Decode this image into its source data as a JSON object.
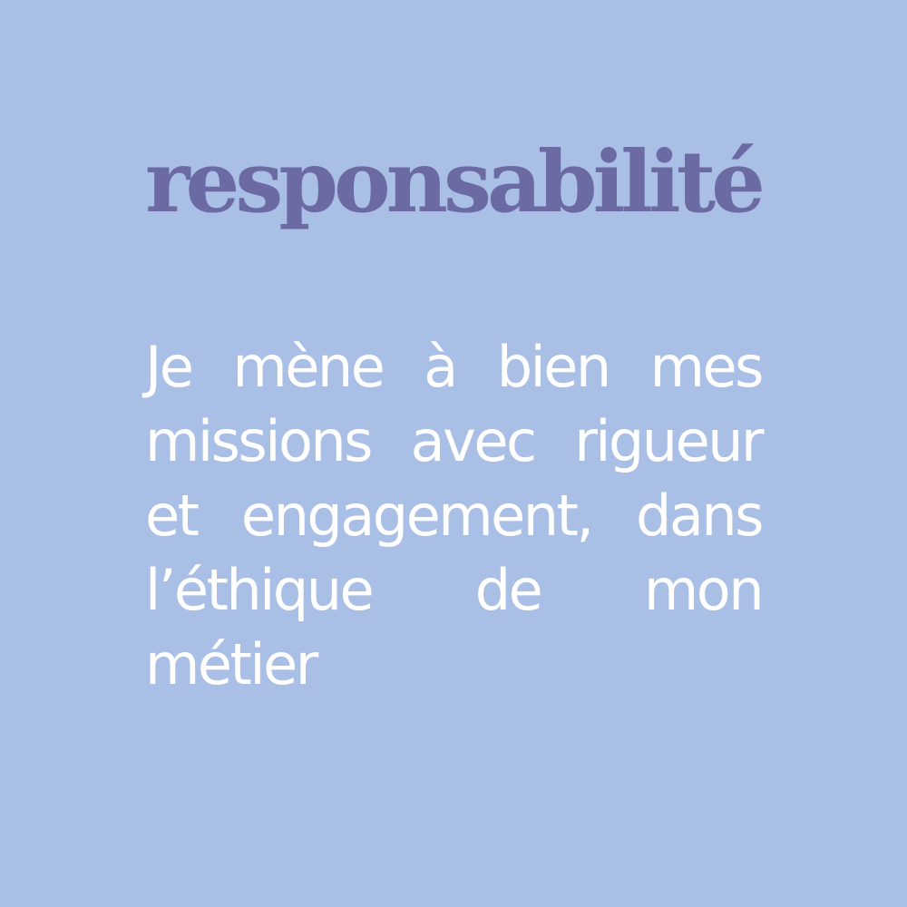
{
  "card": {
    "title": "responsabilité",
    "body": "Je mène à bien mes missions avec rigueur et engagement, dans l’éthique de mon métier",
    "colors": {
      "background": "#aabfe6",
      "title": "#6b6aa3",
      "body": "#ffffff"
    }
  }
}
